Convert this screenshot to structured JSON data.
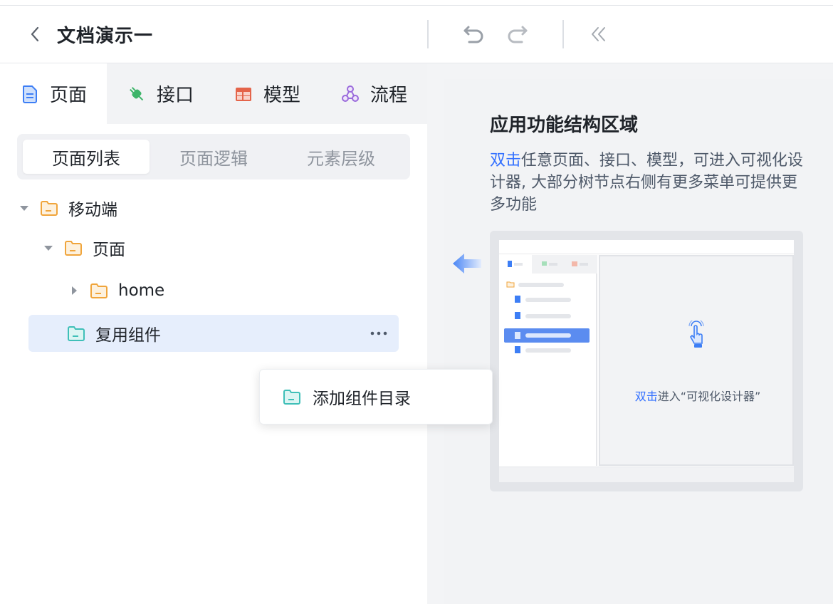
{
  "header": {
    "title": "文档演示一",
    "back_icon": "chevron-left-icon",
    "undo_icon": "undo-icon",
    "redo_icon": "redo-icon",
    "collapse_icon": "double-chevron-left-icon"
  },
  "tabs": [
    {
      "label": "页面",
      "icon": "page-icon",
      "active": true
    },
    {
      "label": "接口",
      "icon": "plug-icon",
      "active": false
    },
    {
      "label": "模型",
      "icon": "table-icon",
      "active": false
    },
    {
      "label": "流程",
      "icon": "flow-icon",
      "active": false
    }
  ],
  "segmented": [
    "页面列表",
    "页面逻辑",
    "元素层级"
  ],
  "tree": [
    {
      "label": "移动端",
      "level": 0,
      "expanded": true
    },
    {
      "label": "页面",
      "level": 1,
      "expanded": true
    },
    {
      "label": "home",
      "level": 2,
      "expanded": false
    },
    {
      "label": "复用组件",
      "level": 1,
      "selected": true
    }
  ],
  "context_menu": {
    "items": [
      "添加组件目录"
    ]
  },
  "guide": {
    "title": "应用功能结构区域",
    "desc_highlight": "双击",
    "desc_rest": "任意页面、接口、模型，可进入可视化设计器, 大部分树节点右侧有更多菜单可提供更多功能",
    "mock_hint_highlight": "双击",
    "mock_hint_rest": "进入“可视化设计器”"
  },
  "colors": {
    "accent": "#3370ff",
    "folder_orange": "#f0a53c",
    "folder_teal": "#3fbfb8",
    "plug_green": "#3eb56a",
    "table_red": "#e4644a",
    "flow_purple": "#9b6bdc"
  }
}
